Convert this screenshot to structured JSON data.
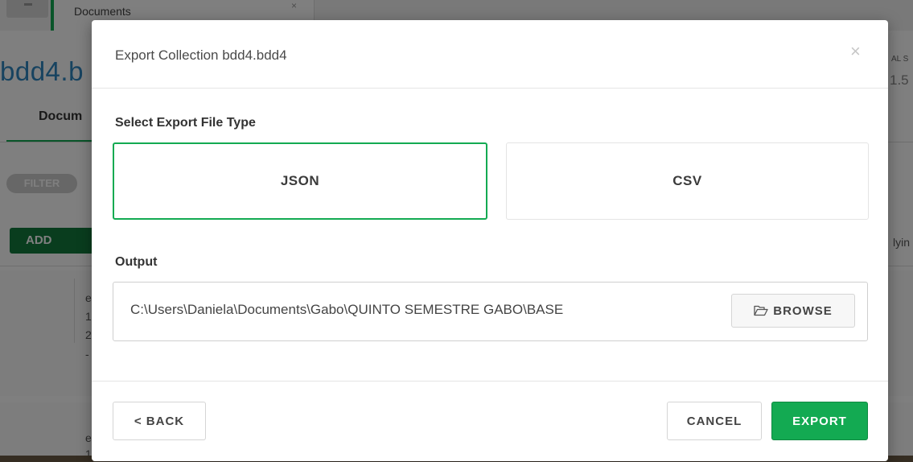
{
  "background": {
    "tab_label": "Documents",
    "tab_close": "×",
    "collection_title": "bdd4.b",
    "right_small": "AL S",
    "right_number": "1.5",
    "documents_tab": "Docum",
    "filter_label": "FILTER",
    "add_button": "ADD",
    "right_text": "lyin",
    "row_chars": [
      "e",
      "1",
      "2",
      "-"
    ],
    "row_chars_b": [
      "e",
      "1"
    ]
  },
  "modal": {
    "title": "Export Collection bdd4.bdd4",
    "close_label": "×",
    "file_type_label": "Select Export File Type",
    "file_types": [
      {
        "label": "JSON",
        "selected": true
      },
      {
        "label": "CSV",
        "selected": false
      }
    ],
    "output_label": "Output",
    "output_path": "C:\\Users\\Daniela\\Documents\\Gabo\\QUINTO SEMESTRE GABO\\BASE",
    "browse_label": "BROWSE",
    "back_label": "< BACK",
    "cancel_label": "CANCEL",
    "export_label": "EXPORT",
    "accent_color": "#13aa52"
  }
}
